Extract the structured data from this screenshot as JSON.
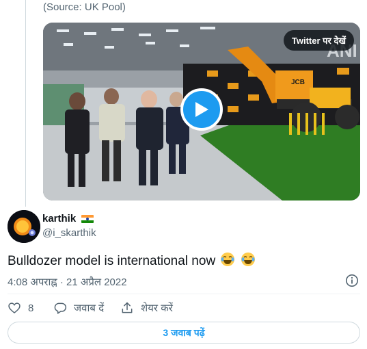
{
  "quoted": {
    "source_text": "(Source: UK Pool)"
  },
  "video": {
    "watch_label": "Twitter पर देखें",
    "watermark": "ANI",
    "brand": "JCB"
  },
  "author": {
    "name": "karthik",
    "handle": "@i_skarthik",
    "flag_colors": [
      "#ff9933",
      "#ffffff",
      "#138808"
    ]
  },
  "tweet": {
    "text": "Bulldozer model is international now",
    "emoji": [
      "face-with-tears-of-joy",
      "face-with-tears-of-joy"
    ]
  },
  "meta": {
    "time": "4:08 अपराह्न",
    "separator": "·",
    "date": "21 अप्रैल 2022",
    "timestamp": "4:08 अपराह्न · 21 अप्रैल 2022"
  },
  "actions": {
    "like_count": "8",
    "reply_label": "जवाब दें",
    "share_label": "शेयर करें"
  },
  "replies_button": {
    "label": "3 जवाब पढ़ें"
  },
  "colors": {
    "accent": "#1d9bf0",
    "like_red": "#f91880",
    "secondary_text": "#536471"
  }
}
